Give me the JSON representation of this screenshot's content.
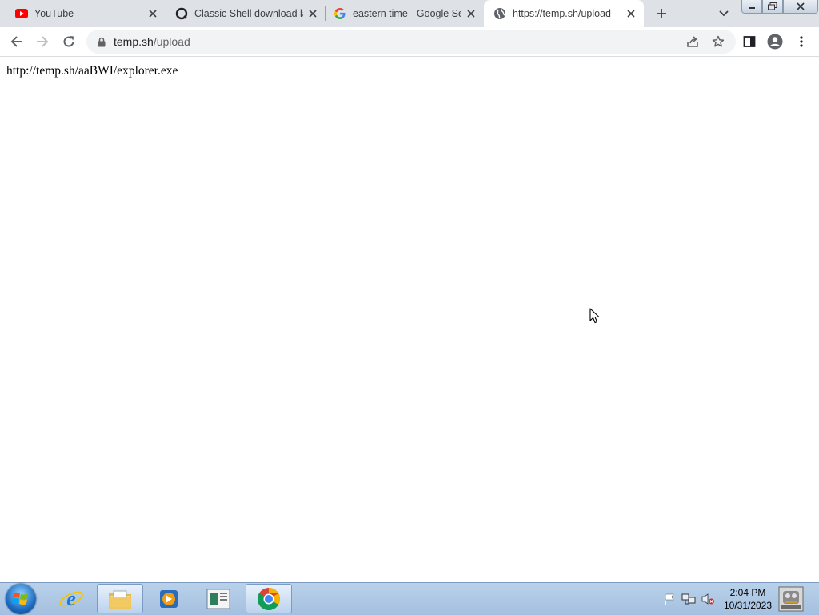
{
  "browser": {
    "tabs": [
      {
        "title": "YouTube",
        "icon": "youtube-icon",
        "active": false
      },
      {
        "title": "Classic Shell download la",
        "icon": "classic-shell-icon",
        "active": false
      },
      {
        "title": "eastern time - Google Sea",
        "icon": "google-icon",
        "active": false
      },
      {
        "title": "https://temp.sh/upload",
        "icon": "globe-icon",
        "active": true
      }
    ],
    "address": {
      "host": "temp.sh",
      "path": "/upload"
    }
  },
  "page": {
    "text": "http://temp.sh/aaBWI/explorer.exe"
  },
  "taskbar": {
    "apps": [
      "internet-explorer-icon",
      "windows-explorer-icon",
      "media-player-icon",
      "notes-icon",
      "chrome-icon"
    ],
    "clock": {
      "time": "2:04 PM",
      "date": "10/31/2023"
    }
  },
  "colors": {
    "tabstrip": "#dee1e6",
    "omnibox": "#f1f3f4",
    "taskbar": "#b9d1ea"
  }
}
